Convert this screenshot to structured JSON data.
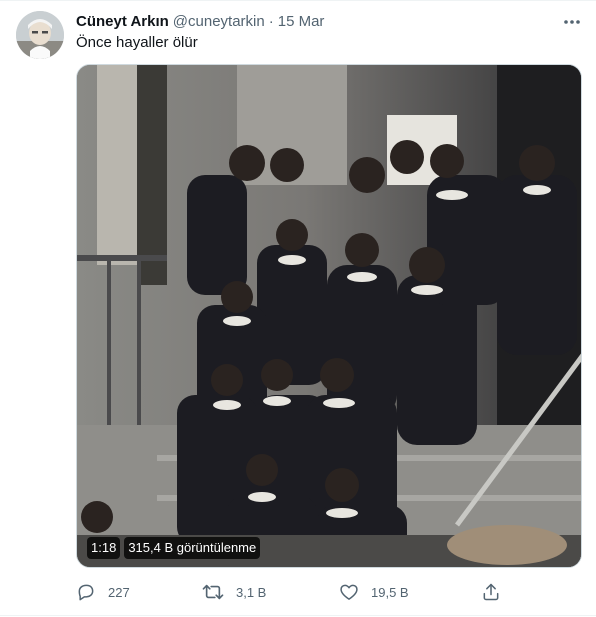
{
  "tweet": {
    "author_name": "Cüneyt Arkın",
    "handle": "@cuneytarkin",
    "separator": "·",
    "date": "15 Mar",
    "text": "Önce hayaller ölür",
    "media": {
      "duration": "1:18",
      "views": "315,4 B görüntülenme"
    },
    "actions": {
      "reply_count": "227",
      "retweet_count": "3,1 B",
      "like_count": "19,5 B"
    }
  },
  "icons": {
    "more": "more-icon",
    "reply": "reply-icon",
    "retweet": "retweet-icon",
    "like": "heart-icon",
    "share": "share-icon"
  },
  "colors": {
    "secondary_text": "#536471",
    "primary_text": "#0f1419",
    "divider": "#eff3f4"
  }
}
